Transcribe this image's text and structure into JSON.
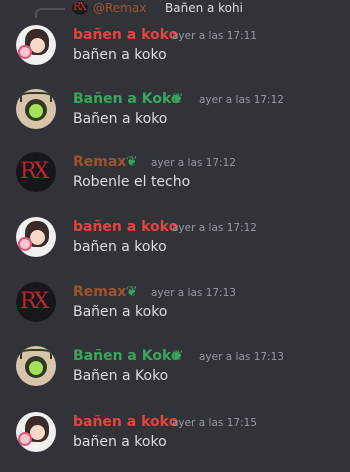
{
  "reply": {
    "avatar_text": "RX",
    "mention": "@Remax",
    "text": "Bañen a kohi"
  },
  "colors": {
    "koko": "#e8433e",
    "Koko": "#3ba55d",
    "remax": "#a0522d",
    "badge": "#3ba55d"
  },
  "messages": [
    {
      "author": "bañen a koko",
      "timestamp": "ayer a las 17:11",
      "content": "bañen a koko"
    },
    {
      "author": "Bañen a Koko",
      "timestamp": "ayer a las 17:12",
      "content": "Bañen a koko",
      "badge": "leaf-badge-icon"
    },
    {
      "author": "Remax",
      "timestamp": "ayer a las 17:12",
      "content": "Robenle el techo",
      "badge": "leaf-badge-icon",
      "avatar_text": "RX"
    },
    {
      "author": "bañen a koko",
      "timestamp": "ayer a las 17:12",
      "content": "bañen a koko"
    },
    {
      "author": "Remax",
      "timestamp": "ayer a las 17:13",
      "content": "Bañen a koko",
      "badge": "leaf-badge-icon",
      "avatar_text": "RX"
    },
    {
      "author": "Bañen a Koko",
      "timestamp": "ayer a las 17:13",
      "content": "Bañen a Koko",
      "badge": "leaf-badge-icon"
    },
    {
      "author": "bañen a koko",
      "timestamp": "ayer a las 17:15",
      "content": "bañen a koko"
    }
  ]
}
